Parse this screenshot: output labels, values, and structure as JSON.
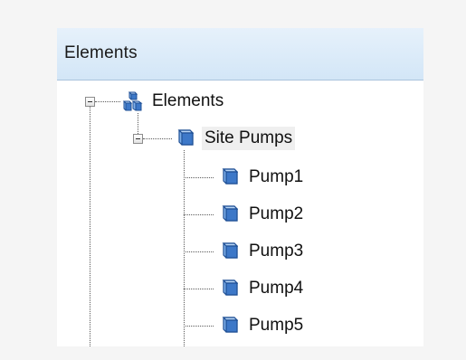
{
  "panel": {
    "title": "Elements"
  },
  "tree": {
    "root": {
      "label": "Elements",
      "icon": "cubes-group-icon",
      "expanded": true
    },
    "group": {
      "label": "Site Pumps",
      "icon": "cube-icon",
      "expanded": true
    },
    "items": [
      {
        "label": "Pump1",
        "icon": "cube-icon"
      },
      {
        "label": "Pump2",
        "icon": "cube-icon"
      },
      {
        "label": "Pump3",
        "icon": "cube-icon"
      },
      {
        "label": "Pump4",
        "icon": "cube-icon"
      },
      {
        "label": "Pump5",
        "icon": "cube-icon"
      }
    ]
  },
  "colors": {
    "header_bg": "#dbeaf8",
    "icon_blue": "#3d78c8",
    "selection": "#efefef"
  }
}
